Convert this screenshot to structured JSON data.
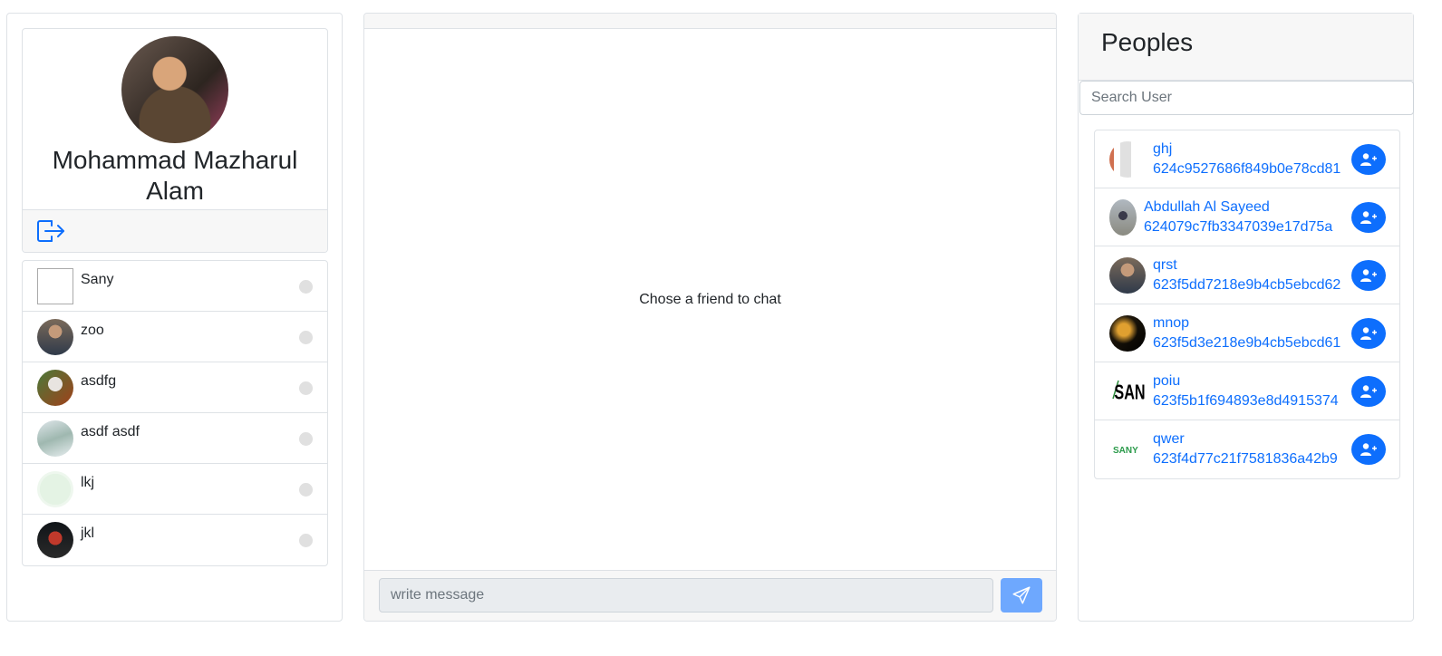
{
  "profile": {
    "name": "Mohammad Mazharul Alam",
    "avatar_icon": "profile-photo"
  },
  "logout_icon": "logout-icon",
  "friends": [
    {
      "name": "Sany",
      "avatar": "broken-image"
    },
    {
      "name": "zoo",
      "avatar": "photo"
    },
    {
      "name": "asdfg",
      "avatar": "photo"
    },
    {
      "name": "asdf asdf",
      "avatar": "photo"
    },
    {
      "name": "lkj",
      "avatar": "photo"
    },
    {
      "name": "jkl",
      "avatar": "photo"
    }
  ],
  "chat": {
    "empty_text": "Chose a friend to chat",
    "message_placeholder": "write message",
    "send_icon": "send-icon"
  },
  "people": {
    "title": "Peoples",
    "search_placeholder": "Search User",
    "add_icon": "add-user-icon",
    "users": [
      {
        "name": "ghj",
        "id": "624c9527686f849b0e78cd81"
      },
      {
        "name": "Abdullah Al Sayeed",
        "id": "624079c7fb3347039e17d75a"
      },
      {
        "name": "qrst",
        "id": "623f5dd7218e9b4cb5ebcd62"
      },
      {
        "name": "mnop",
        "id": "623f5d3e218e9b4cb5ebcd61"
      },
      {
        "name": "poiu",
        "id": "623f5b1f694893e8d4915374"
      },
      {
        "name": "qwer",
        "id": "623f4d77c21f7581836a42b9"
      }
    ]
  },
  "colors": {
    "primary": "#0d6efd",
    "send_button": "#6ea8fe",
    "header_bg": "#f7f7f7",
    "status_offline": "#e0e0e0"
  }
}
